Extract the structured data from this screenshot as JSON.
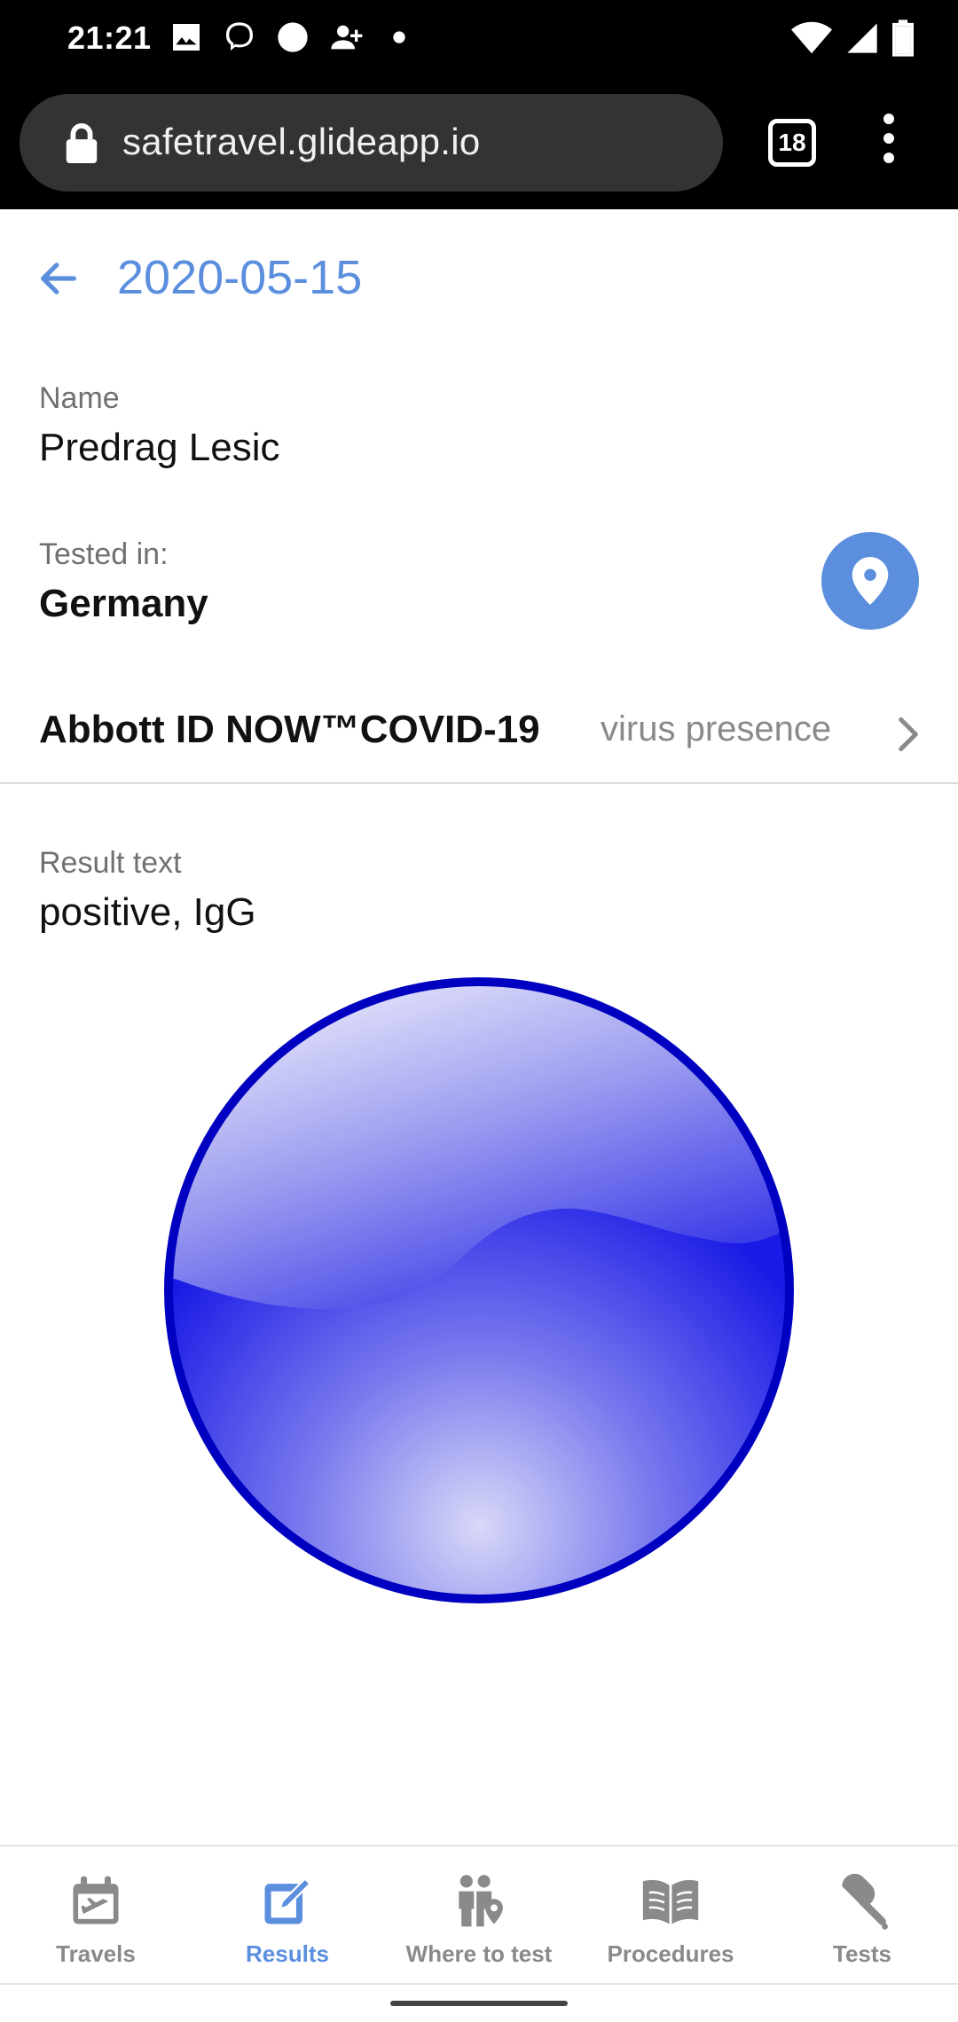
{
  "status_bar": {
    "time": "21:21"
  },
  "browser": {
    "url": "safetravel.glideapp.io",
    "tab_count": "18"
  },
  "header": {
    "title": "2020-05-15"
  },
  "fields": {
    "name_label": "Name",
    "name_value": "Predrag Lesic",
    "tested_in_label": "Tested in:",
    "tested_in_value": "Germany",
    "result_label": "Result text",
    "result_value": "positive, IgG"
  },
  "test": {
    "name": "Abbott ID NOW™COVID-19",
    "type": "virus presence"
  },
  "bottom_nav": {
    "items": [
      {
        "label": "Travels",
        "icon": "calendar-plane-icon"
      },
      {
        "label": "Results",
        "icon": "edit-note-icon"
      },
      {
        "label": "Where to test",
        "icon": "people-location-icon"
      },
      {
        "label": "Procedures",
        "icon": "open-book-icon"
      },
      {
        "label": "Tests",
        "icon": "swab-icon"
      }
    ],
    "active": "Results"
  },
  "colors": {
    "accent": "#5b8fde",
    "ball_blue": "#1a1ae6",
    "ball_border": "#0000c0"
  }
}
